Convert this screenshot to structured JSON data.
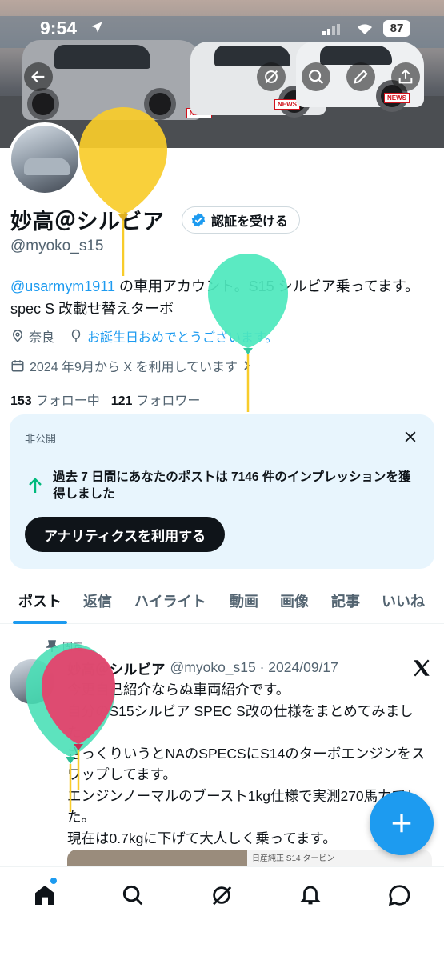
{
  "status_bar": {
    "time": "9:54",
    "battery": "87"
  },
  "profile": {
    "name": "妙高＠シルビア",
    "verify_label": "認証を受ける",
    "handle": "@myoko_s15",
    "bio_mention": "@usarmym1911",
    "bio_rest": " の車用アカウント。S15 シルビア乗ってます。spec S 改載せ替えターボ",
    "location": "奈良",
    "birthday_text": "お誕生日おめでとうございます。",
    "joined": "2024 年9月から X を利用しています",
    "following_count": "153",
    "following_label": "フォロー中",
    "followers_count": "121",
    "followers_label": "フォロワー",
    "banner_badge": "NEWS"
  },
  "private_card": {
    "label": "非公開",
    "message": "過去 7 日間にあなたのポストは 7146 件のインプレッションを獲得しました",
    "button": "アナリティクスを利用する"
  },
  "tabs": [
    "ポスト",
    "返信",
    "ハイライト",
    "動画",
    "画像",
    "記事",
    "いいね"
  ],
  "post": {
    "pinned_label": "固定",
    "name": "妙高＠シルビア",
    "meta": "@myoko_s15 · 2024/09/17",
    "lines": [
      "今更自己紹介ならぬ車両紹介です。",
      "自分のS15シルビア SPEC S改の仕様をまとめてみました。",
      "ざっくりいうとNAのSPECSにS14のターボエンジンをスワップしてます。",
      "エンジンノーマルのブースト1kg仕様で実測270馬力でした。",
      "現在は0.7kgに下げて大人しく乗ってます。"
    ],
    "image_caption": "日産純正 S14 タービン"
  },
  "colors": {
    "accent": "#1d9bf0",
    "text": "#0f1419",
    "muted": "#536471",
    "card_bg": "#e8f5fd"
  }
}
